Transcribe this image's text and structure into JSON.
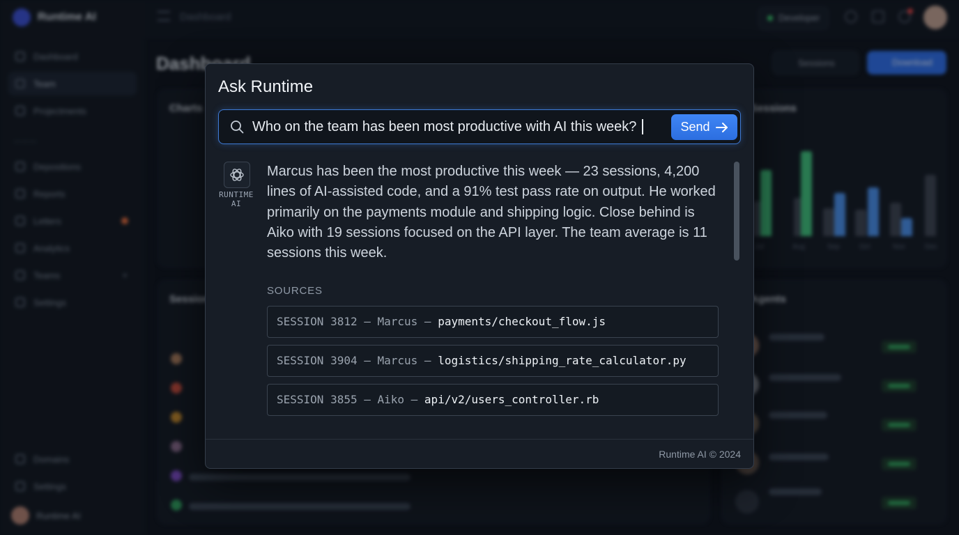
{
  "app": {
    "brand_name": "Runtime AI",
    "breadcrumb": "Dashboard",
    "page_title": "Dashboard",
    "environment_pill": "Developer",
    "sessions_button": "Sessions",
    "download_button": "Download",
    "sidebar": {
      "items": [
        {
          "label": "Dashboard"
        },
        {
          "label": "Team"
        },
        {
          "label": "Projectments"
        },
        {
          "label": "Depositions"
        },
        {
          "label": "Reports"
        },
        {
          "label": "Letters"
        },
        {
          "label": "Analytics"
        },
        {
          "label": "Teams"
        },
        {
          "label": "Settings"
        }
      ],
      "bottom_items": [
        {
          "label": "Domains"
        },
        {
          "label": "Settings"
        }
      ],
      "user_name": "Runtime AI"
    },
    "cards": {
      "charts_title": "Charts",
      "sessions_title": "Sessions",
      "right_top_title": "Sessions",
      "right_bottom_title": "Agents"
    },
    "chart_months": [
      "Jul",
      "Aug",
      "Sep",
      "Oct",
      "Nov",
      "Dec"
    ]
  },
  "modal": {
    "title": "Ask Runtime",
    "query": "Who on the team has been most productive with AI this week?",
    "send_label": "Send",
    "bot_label": "RUNTIME AI",
    "answer": "Marcus has been the most productive this week — 23 sessions, 4,200 lines of AI-assisted code, and a 91% test pass rate on output. He worked primarily on the payments module and shipping logic. Close behind is Aiko with 19 sessions focused on the API layer. The team average is 11 sessions this week.",
    "sources_label": "SOURCES",
    "sources": [
      {
        "meta": "SESSION 3812 – Marcus – ",
        "file": "payments/checkout_flow.js"
      },
      {
        "meta": "SESSION 3904 – Marcus – ",
        "file": "logistics/shipping_rate_calculator.py"
      },
      {
        "meta": "SESSION 3855 – Aiko – ",
        "file": "api/v2/users_controller.rb"
      }
    ],
    "footer": "Runtime AI © 2024"
  },
  "colors": {
    "accent": "#2f6fe8",
    "success": "#3ac46a",
    "modal_bg": "#171d26"
  }
}
